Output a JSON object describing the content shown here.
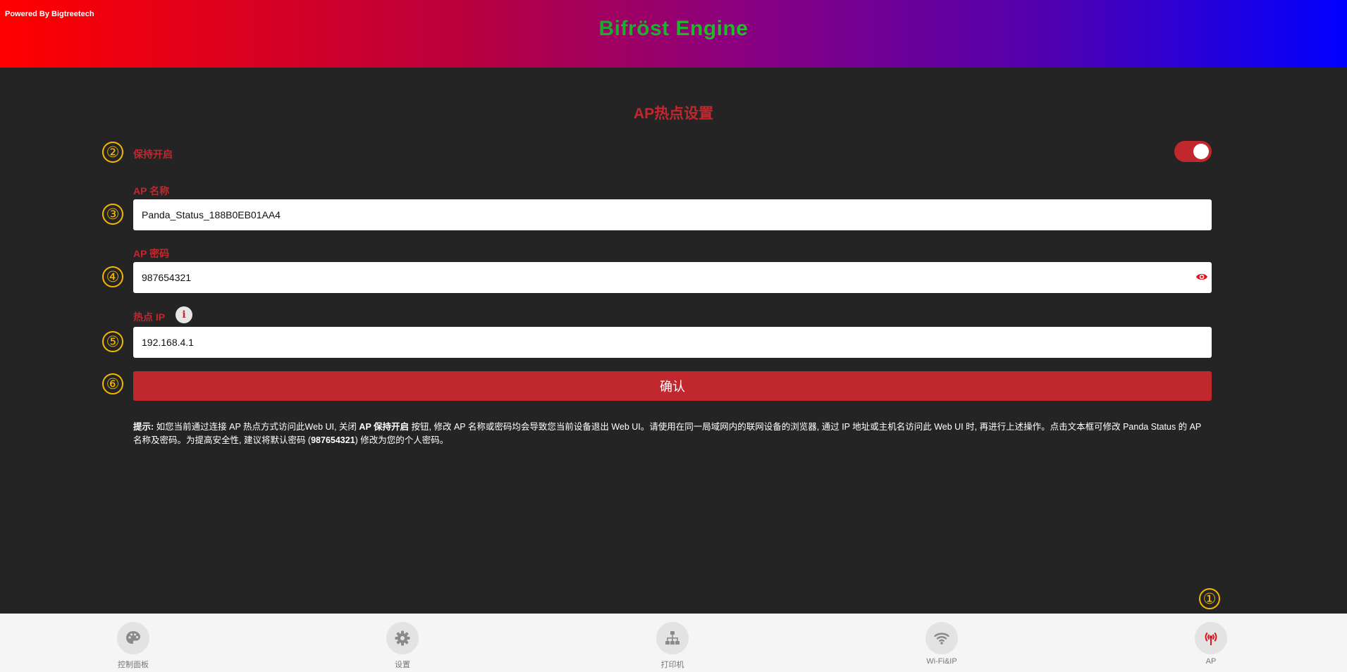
{
  "header": {
    "powered_by": "Powered By Bigtreetech",
    "brand_title": "Bifröst Engine"
  },
  "page": {
    "title": "AP热点设置"
  },
  "markers": [
    "①",
    "②",
    "③",
    "④",
    "⑤",
    "⑥"
  ],
  "form": {
    "keep_on_label": "保持开启",
    "keep_on_enabled": true,
    "ap_name_label": "AP 名称",
    "ap_name_value": "Panda_Status_188B0EB01AA4",
    "ap_password_label": "AP 密码",
    "ap_password_value": "987654321",
    "hotspot_ip_label": "热点 IP",
    "hotspot_ip_value": "192.168.4.1",
    "info_icon_glyph": "i",
    "confirm_label": "确认"
  },
  "hint": {
    "prefix": "提示:",
    "part1": " 如您当前通过连接 AP 热点方式访问此Web UI, 关闭 ",
    "keep_on_bold": "AP 保持开启",
    "part2": " 按钮, 修改 AP 名称或密码均会导致您当前设备退出 Web UI。请使用在同一局域网内的联网设备的浏览器, 通过 IP 地址或主机名访问此 Web UI 时, 再进行上述操作。点击文本框可修改 Panda Status 的 AP 名称及密码。为提高安全性, 建议将默认密码 (",
    "default_password": "987654321",
    "part3": ") 修改为您的个人密码。"
  },
  "bottom_nav": {
    "items": [
      {
        "label": "控制面板",
        "icon": "palette-icon"
      },
      {
        "label": "设置",
        "icon": "gear-icon"
      },
      {
        "label": "打印机",
        "icon": "network-tree-icon"
      },
      {
        "label": "Wi-Fi&IP",
        "icon": "wifi-icon"
      },
      {
        "label": "AP",
        "icon": "broadcast-tower-icon",
        "active": true
      }
    ]
  },
  "colors": {
    "accent": "#c0282e",
    "marker": "#f5b800",
    "background": "#252424",
    "nav_background": "#f5f5f5"
  }
}
